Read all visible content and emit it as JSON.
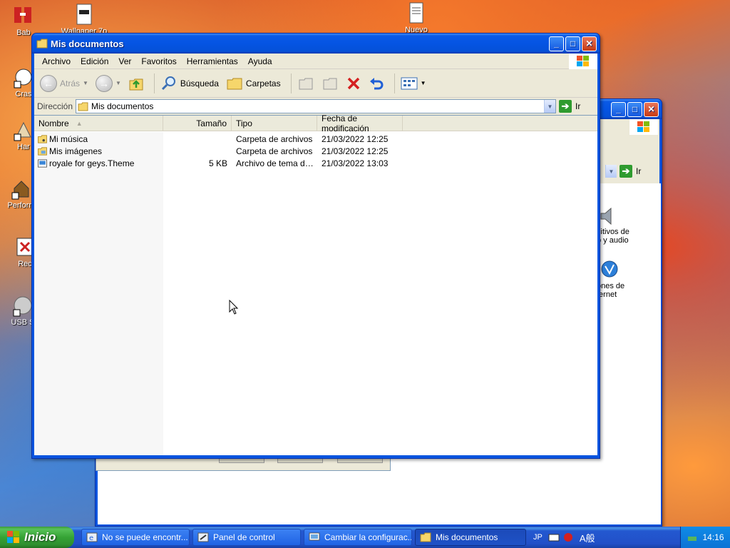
{
  "desktop": {
    "icons": [
      {
        "label": "Bab",
        "icon": "app-shortcut-icon"
      },
      {
        "label": "Wallpaper 7p",
        "icon": "document-icon"
      },
      {
        "label": "Nuevo",
        "icon": "text-document-icon"
      },
      {
        "label": "Cras",
        "icon": "crash-shortcut-icon"
      },
      {
        "label": "Har",
        "icon": "shortcut-icon"
      },
      {
        "label": "Perform",
        "icon": "performance-shortcut-icon"
      },
      {
        "label": "Rec",
        "icon": "recorder-shortcut-icon"
      },
      {
        "label": "USB S",
        "icon": "usb-shortcut-icon"
      }
    ]
  },
  "main_window": {
    "title": "Mis documentos",
    "menu": [
      "Archivo",
      "Edición",
      "Ver",
      "Favoritos",
      "Herramientas",
      "Ayuda"
    ],
    "toolbar": {
      "back_label": "Atrás",
      "search_label": "Búsqueda",
      "folders_label": "Carpetas"
    },
    "address": {
      "label": "Dirección",
      "value": "Mis documentos",
      "go_label": "Ir"
    },
    "columns": {
      "name": "Nombre",
      "size": "Tamaño",
      "type": "Tipo",
      "modified": "Fecha de modificación"
    },
    "files": [
      {
        "name": "Mi música",
        "size": "",
        "type": "Carpeta de archivos",
        "modified": "21/03/2022 12:25",
        "icon": "music-folder-icon"
      },
      {
        "name": "Mis imágenes",
        "size": "",
        "type": "Carpeta de archivos",
        "modified": "21/03/2022 12:25",
        "icon": "pictures-folder-icon"
      },
      {
        "name": "royale for geys.Theme",
        "size": "5 KB",
        "type": "Archivo de tema de ...",
        "modified": "21/03/2022 13:03",
        "icon": "theme-file-icon"
      }
    ]
  },
  "background_window": {
    "go_label": "Ir",
    "items": [
      "sitivos de",
      "o y audio",
      "ones de",
      "ternet"
    ]
  },
  "taskbar": {
    "start_label": "Inicio",
    "tasks": [
      {
        "label": "No se puede encontr...",
        "icon": "ie-icon"
      },
      {
        "label": "Panel de control",
        "icon": "control-panel-icon"
      },
      {
        "label": "Cambiar la configurac...",
        "icon": "display-settings-icon"
      },
      {
        "label": "Mis documentos",
        "icon": "folder-icon"
      }
    ],
    "ime": {
      "lang": "JP",
      "mode": "A般"
    },
    "clock": "14:16"
  },
  "colors": {
    "titlebar_blue": "#0554e3",
    "taskbar_blue": "#2250c8",
    "start_green": "#35a335",
    "go_green": "#2f9b2f",
    "delete_red": "#d42020"
  }
}
